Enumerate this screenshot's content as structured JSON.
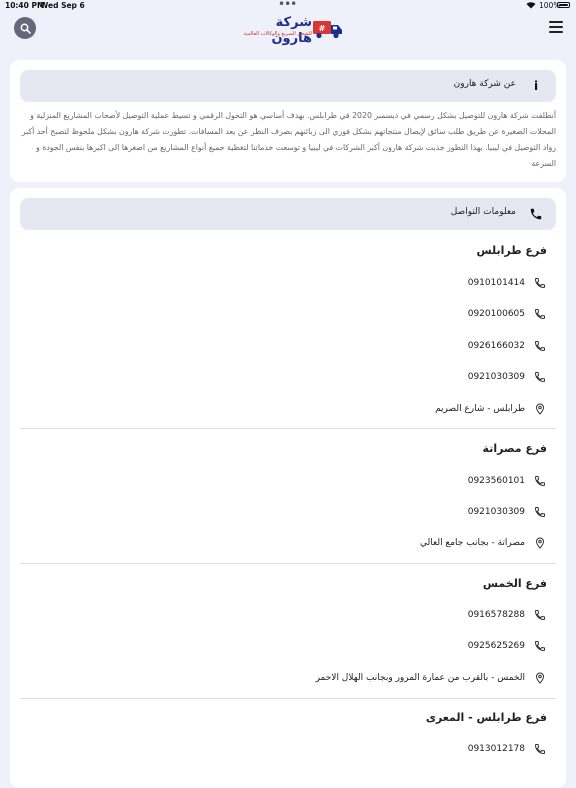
{
  "status_bar": {
    "time": "10:40 PM",
    "date": "Wed Sep 6",
    "battery": "100%"
  },
  "header": {
    "brand": "شركة هارون",
    "tagline": "للشحن السريع والوكالات العالمية"
  },
  "about": {
    "title": "عن شركة هارون",
    "text": "أنطلقت شركة هارون للتوصيل بشكل رسمي في ديسمبر 2020 في طرابلس. بهدف أساسي هو التحول الرقمي و تسيط عملية التوصيل لأصحاب المشاريع المنزلية و المحلات الصغيرة عن طريق طلب سائق لإيصال منتجاتهم بشكل فوري الى زبائنهم بصرف النظر عن بعد المسافات. تطورت شركة هارون بشكل ملحوظ لتصبح أحد أكبر رواد التوصيل في ليبيا. بهذا التطور جذبت شركة هارون أكبر الشركات في ليبيا و توسعت خدماتنا لتغطية جميع أنواع المشاريع من اصغرها الى اكبرها بنفس الجودة و السرعة"
  },
  "contact": {
    "title": "معلومات التواصل",
    "branches": [
      {
        "name": "فرع طرابلس",
        "phones": [
          "0910101414",
          "0920100605",
          "0926166032",
          "0921030309"
        ],
        "address": "طرابلس - شارع الصريم"
      },
      {
        "name": "فرع مصراتة",
        "phones": [
          "0923560101",
          "0921030309"
        ],
        "address": "مصراتة - بجانب جامع العالي"
      },
      {
        "name": "فرع الخمس",
        "phones": [
          "0916578288",
          "0925625269"
        ],
        "address": "الخمس - بالقرب من عمارة المرور وبجانب الهلال الاحمر"
      },
      {
        "name": "فرع طرابلس - المعرى",
        "phones": [
          "0913012178"
        ]
      }
    ]
  },
  "colors": {
    "background": "#eef1f9",
    "card": "#ffffff",
    "header_fill": "#e5e7f1",
    "brand_blue": "#1e2f8a",
    "brand_red": "#c73232"
  },
  "icons": {
    "search": "search-icon",
    "menu": "menu-icon",
    "info": "info-icon",
    "phone": "phone-icon",
    "location": "location-icon"
  }
}
